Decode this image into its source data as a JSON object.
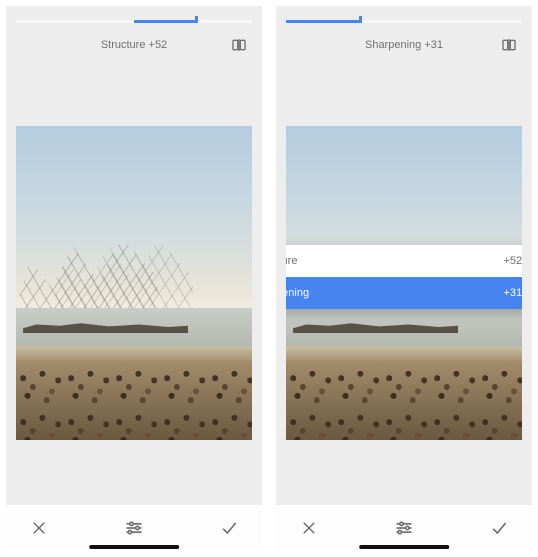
{
  "screens": [
    {
      "param_name": "Structure",
      "param_value": "+52",
      "slider_fill_left_pct": 50,
      "slider_fill_width_pct": 26,
      "slider_handle_left_pct": 76
    },
    {
      "param_name": "Sharpening",
      "param_value": "+31",
      "slider_fill_left_pct": 0,
      "slider_fill_width_pct": 31,
      "slider_handle_left_pct": 31,
      "popup": {
        "items": [
          {
            "label": "Structure",
            "value": "+52",
            "active": false
          },
          {
            "label": "Sharpening",
            "value": "+31",
            "active": true
          }
        ]
      }
    }
  ],
  "icons": {
    "compare": "compare-icon",
    "cancel": "cancel-icon",
    "adjust": "adjust-icon",
    "accept": "accept-icon"
  }
}
